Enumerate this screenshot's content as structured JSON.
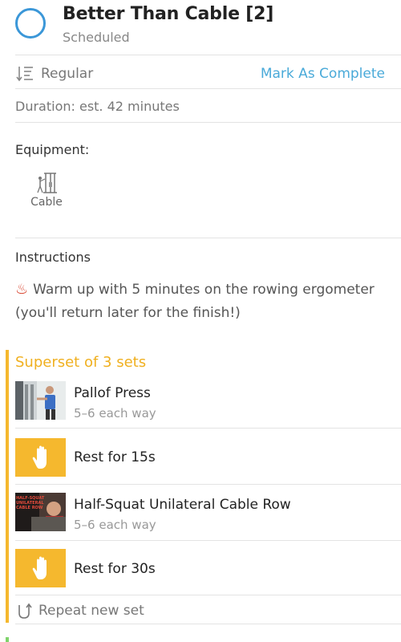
{
  "header": {
    "title": "Better Than Cable [2]",
    "status": "Scheduled",
    "status_icon": "circle-outline-icon",
    "accent_color": "#3b97d8"
  },
  "actions": {
    "mode_label": "Regular",
    "mode_icon": "sort-icon",
    "mark_complete": "Mark As Complete",
    "link_color": "#4aaad9"
  },
  "duration": "Duration: est. 42 minutes",
  "equipment": {
    "heading": "Equipment:",
    "items": [
      {
        "label": "Cable",
        "icon": "cable-machine-icon"
      }
    ]
  },
  "instructions": {
    "heading": "Instructions",
    "text": "Warm up with 5 minutes on the rowing ergometer (you'll return later for the finish!)",
    "emoji": "♨"
  },
  "superset": {
    "title": "Superset of 3 sets",
    "color": "#f5b82e",
    "items": [
      {
        "type": "exercise",
        "name": "Pallof Press",
        "reps": "5–6 each way",
        "thumbnail": "pallof-press-thumbnail"
      },
      {
        "type": "rest",
        "label": "Rest for 15s",
        "icon": "hand-icon"
      },
      {
        "type": "exercise",
        "name": "Half-Squat Unilateral Cable Row",
        "reps": "5–6 each way",
        "thumbnail": "cable-row-thumbnail",
        "thumbnail_text": "HALF-SQUAT UNILATERAL CABLE ROW"
      },
      {
        "type": "rest",
        "label": "Rest for 30s",
        "icon": "hand-icon"
      }
    ],
    "repeat_label": "Repeat new set",
    "repeat_icon": "repeat-icon"
  }
}
